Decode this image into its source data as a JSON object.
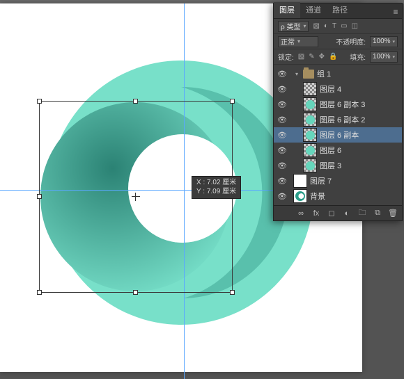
{
  "canvas": {
    "tooltip_line1": "X : 7.02 厘米",
    "tooltip_line2": "Y : 7.09 厘米"
  },
  "panel": {
    "tabs": {
      "layers": "图层",
      "channels": "通道",
      "paths": "路径"
    },
    "filter_label": "ρ 类型",
    "blend_mode": "正常",
    "opacity_label": "不透明度:",
    "opacity_value": "100%",
    "lock_label": "锁定:",
    "fill_label": "填充:",
    "fill_value": "100%"
  },
  "layers": [
    {
      "kind": "group",
      "indent": 0,
      "name": "组 1",
      "visible": true,
      "open": true
    },
    {
      "kind": "shape",
      "indent": 1,
      "name": "图层 4",
      "visible": true,
      "thumb": "blank"
    },
    {
      "kind": "shape",
      "indent": 1,
      "name": "图层 6 副本 3",
      "visible": true,
      "thumb": "circ"
    },
    {
      "kind": "shape",
      "indent": 1,
      "name": "图层 6 副本 2",
      "visible": true,
      "thumb": "circ"
    },
    {
      "kind": "shape",
      "indent": 1,
      "name": "图层 6 副本",
      "visible": true,
      "thumb": "circ",
      "selected": true
    },
    {
      "kind": "shape",
      "indent": 1,
      "name": "图层 6",
      "visible": true,
      "thumb": "circ"
    },
    {
      "kind": "shape",
      "indent": 1,
      "name": "图层 3",
      "visible": true,
      "thumb": "circ"
    },
    {
      "kind": "layer",
      "indent": 0,
      "name": "图层 7",
      "visible": true,
      "thumb": "white"
    },
    {
      "kind": "layer",
      "indent": 0,
      "name": "背景",
      "visible": true,
      "thumb": "ring"
    }
  ]
}
